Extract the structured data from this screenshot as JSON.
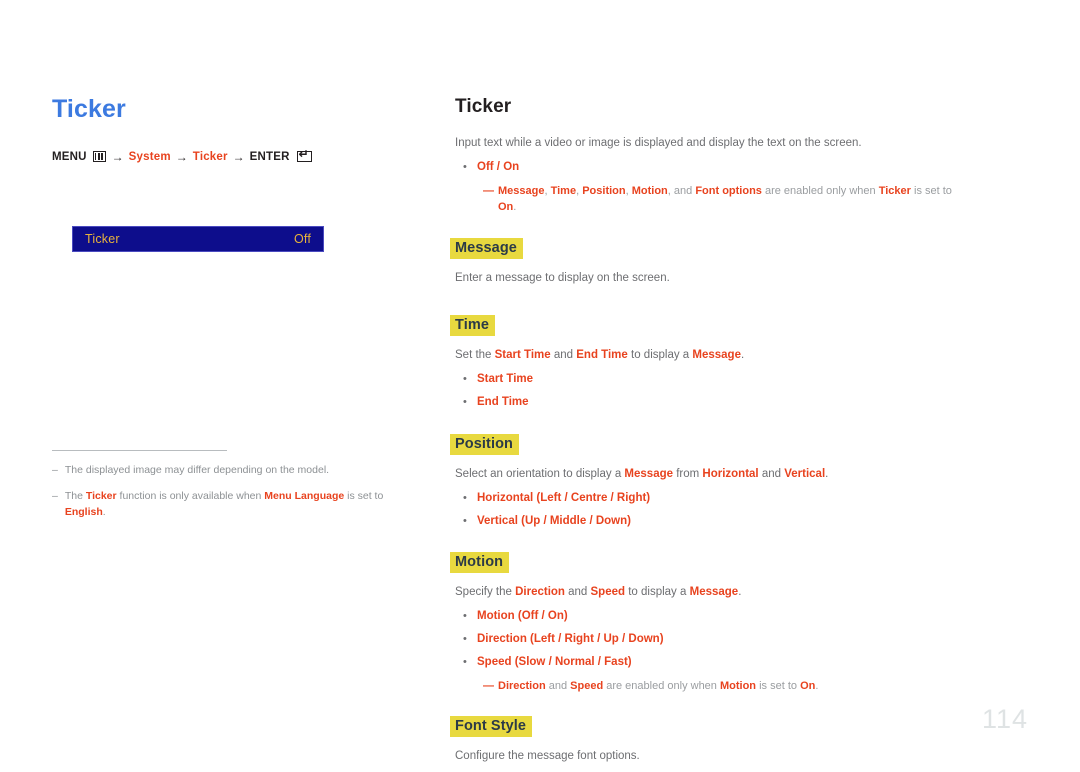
{
  "left": {
    "title": "Ticker",
    "breadcrumb": {
      "menu_label": "MENU",
      "menu_icon": "menu-panel-icon",
      "arrow1": "→",
      "system_label": "System",
      "arrow2": "→",
      "ticker_label": "Ticker",
      "arrow3": "→",
      "enter_label": "ENTER",
      "enter_icon": "enter-return-icon"
    },
    "osd": {
      "label": "Ticker",
      "value": "Off",
      "bg_color": "#0d0d8c",
      "text_color": "#e8b33c"
    },
    "footnotes": [
      {
        "dash": "–",
        "parts": [
          {
            "text": "The displayed image may differ depending on the model.",
            "bold": false
          }
        ]
      },
      {
        "dash": "–",
        "parts": [
          {
            "text": "The ",
            "bold": false
          },
          {
            "text": "Ticker",
            "bold": true
          },
          {
            "text": " function is only available when ",
            "bold": false
          },
          {
            "text": "Menu Language",
            "bold": true
          },
          {
            "text": " is set to ",
            "bold": false
          },
          {
            "text": "English",
            "bold": true
          },
          {
            "text": ".",
            "bold": false
          }
        ]
      }
    ]
  },
  "right": {
    "title": "Ticker",
    "intro": [
      {
        "text": "Input text while a video or image is displayed and display the text on the screen.",
        "bold": false
      }
    ],
    "intro_bullets": [
      {
        "dot": "•",
        "parts": [
          {
            "text": "Off / On",
            "bold": true
          }
        ]
      }
    ],
    "intro_subnote": {
      "dash": "—",
      "parts": [
        {
          "text": "Message",
          "bold": true
        },
        {
          "text": ", ",
          "bold": false
        },
        {
          "text": "Time",
          "bold": true
        },
        {
          "text": ", ",
          "bold": false
        },
        {
          "text": "Position",
          "bold": true
        },
        {
          "text": ", ",
          "bold": false
        },
        {
          "text": "Motion",
          "bold": true
        },
        {
          "text": ", and ",
          "bold": false
        },
        {
          "text": "Font options",
          "bold": true
        },
        {
          "text": " are enabled only when ",
          "bold": false
        },
        {
          "text": "Ticker",
          "bold": true
        },
        {
          "text": " is set to ",
          "bold": false
        },
        {
          "text": "On",
          "bold": true
        },
        {
          "text": ".",
          "bold": false
        }
      ]
    },
    "sections": [
      {
        "heading": "Message",
        "paragraph": [
          {
            "text": "Enter a message to display on the screen.",
            "bold": false
          }
        ],
        "bullets": [],
        "subnote": null
      },
      {
        "heading": "Time",
        "paragraph": [
          {
            "text": "Set the ",
            "bold": false
          },
          {
            "text": "Start Time",
            "bold": true
          },
          {
            "text": " and ",
            "bold": false
          },
          {
            "text": "End Time",
            "bold": true
          },
          {
            "text": " to display a ",
            "bold": false
          },
          {
            "text": "Message",
            "bold": true
          },
          {
            "text": ".",
            "bold": false
          }
        ],
        "bullets": [
          {
            "dot": "•",
            "parts": [
              {
                "text": "Start Time",
                "bold": true
              }
            ]
          },
          {
            "dot": "•",
            "parts": [
              {
                "text": "End Time",
                "bold": true
              }
            ]
          }
        ],
        "subnote": null
      },
      {
        "heading": "Position",
        "paragraph": [
          {
            "text": "Select an orientation to display a ",
            "bold": false
          },
          {
            "text": "Message",
            "bold": true
          },
          {
            "text": " from ",
            "bold": false
          },
          {
            "text": "Horizontal",
            "bold": true
          },
          {
            "text": " and ",
            "bold": false
          },
          {
            "text": "Vertical",
            "bold": true
          },
          {
            "text": ".",
            "bold": false
          }
        ],
        "bullets": [
          {
            "dot": "•",
            "parts": [
              {
                "text": "Horizontal (Left / Centre / Right)",
                "bold": true
              }
            ]
          },
          {
            "dot": "•",
            "parts": [
              {
                "text": "Vertical (Up / Middle / Down)",
                "bold": true
              }
            ]
          }
        ],
        "subnote": null
      },
      {
        "heading": "Motion",
        "paragraph": [
          {
            "text": "Specify the ",
            "bold": false
          },
          {
            "text": "Direction",
            "bold": true
          },
          {
            "text": " and ",
            "bold": false
          },
          {
            "text": "Speed",
            "bold": true
          },
          {
            "text": " to display a ",
            "bold": false
          },
          {
            "text": "Message",
            "bold": true
          },
          {
            "text": ".",
            "bold": false
          }
        ],
        "bullets": [
          {
            "dot": "•",
            "parts": [
              {
                "text": "Motion (Off / On)",
                "bold": true
              }
            ]
          },
          {
            "dot": "•",
            "parts": [
              {
                "text": "Direction (Left / Right / Up / Down)",
                "bold": true
              }
            ]
          },
          {
            "dot": "•",
            "parts": [
              {
                "text": "Speed (Slow / Normal / Fast)",
                "bold": true
              }
            ]
          }
        ],
        "subnote": {
          "dash": "—",
          "parts": [
            {
              "text": "Direction",
              "bold": true
            },
            {
              "text": " and ",
              "bold": false
            },
            {
              "text": "Speed",
              "bold": true
            },
            {
              "text": " are enabled only when ",
              "bold": false
            },
            {
              "text": "Motion",
              "bold": true
            },
            {
              "text": " is set to ",
              "bold": false
            },
            {
              "text": "On",
              "bold": true
            },
            {
              "text": ".",
              "bold": false
            }
          ]
        }
      },
      {
        "heading": "Font Style",
        "paragraph": [
          {
            "text": "Configure the message font options.",
            "bold": false
          }
        ],
        "bullets": [],
        "subnote": null
      }
    ]
  },
  "page_number": "114",
  "colors": {
    "accent_red": "#e8431f",
    "title_blue": "#3c7ae0",
    "highlight_yellow": "#e8d93f",
    "osd_blue": "#0d0d8c",
    "osd_gold": "#e8b33c",
    "body_gray": "#6d6e71",
    "page_num_gray": "#dfe3e4"
  }
}
